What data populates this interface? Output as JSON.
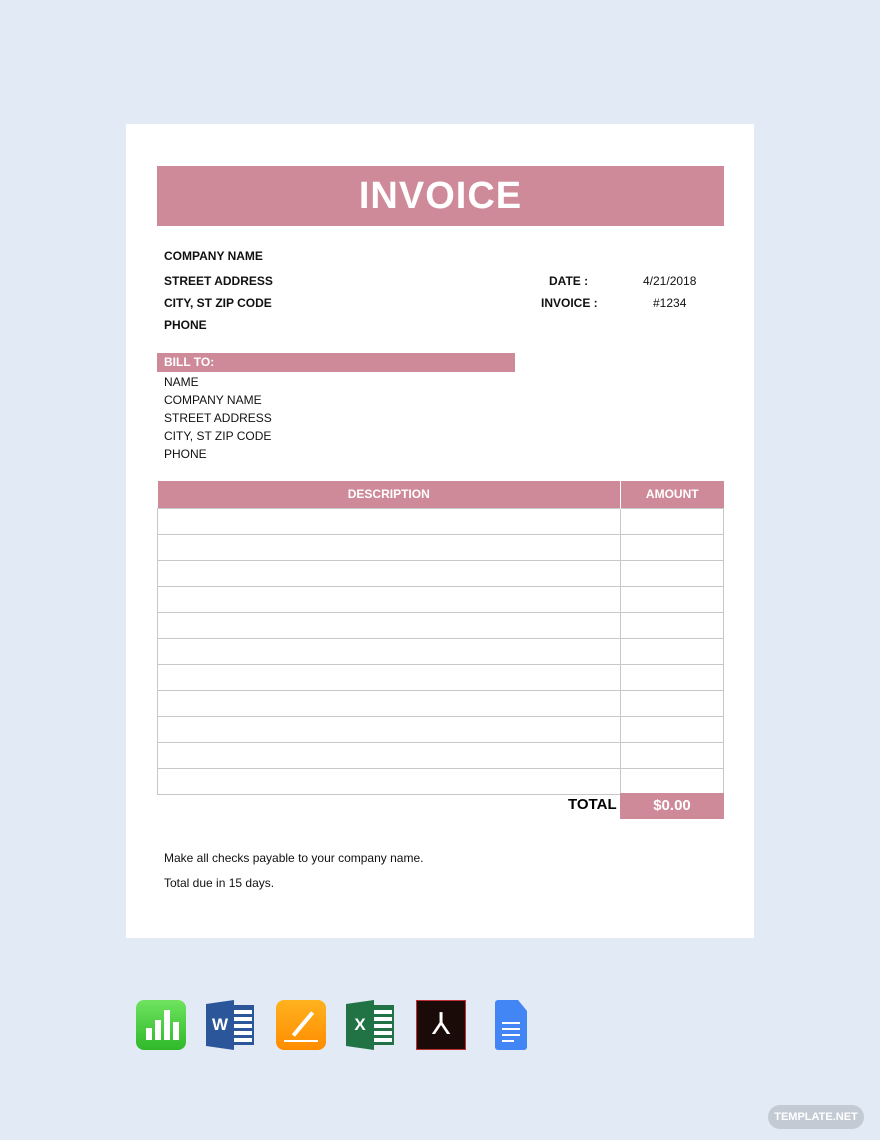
{
  "invoice": {
    "title": "INVOICE",
    "sender": {
      "company": "COMPANY NAME",
      "street": "STREET ADDRESS",
      "city": "CITY, ST ZIP CODE",
      "phone": "PHONE"
    },
    "meta": {
      "date_label": "DATE :",
      "date_value": "4/21/2018",
      "invoice_label": "INVOICE :",
      "invoice_value": "#1234"
    },
    "bill_to": {
      "label": "BILL TO:",
      "name": "NAME",
      "company": "COMPANY NAME",
      "street": "STREET ADDRESS",
      "city": "CITY, ST ZIP CODE",
      "phone": "PHONE"
    },
    "table": {
      "headers": [
        "DESCRIPTION",
        "AMOUNT"
      ]
    },
    "total_label": "TOTAL",
    "total_value": "$0.00",
    "notes": [
      "Make all checks payable to your company name.",
      "Total due in 15 days."
    ]
  },
  "accent_color": "#cf8a9a",
  "format_icons": [
    "numbers-icon",
    "word-icon",
    "pages-icon",
    "excel-icon",
    "pdf-icon",
    "google-docs-icon"
  ],
  "watermark": "TEMPLATE.NET"
}
